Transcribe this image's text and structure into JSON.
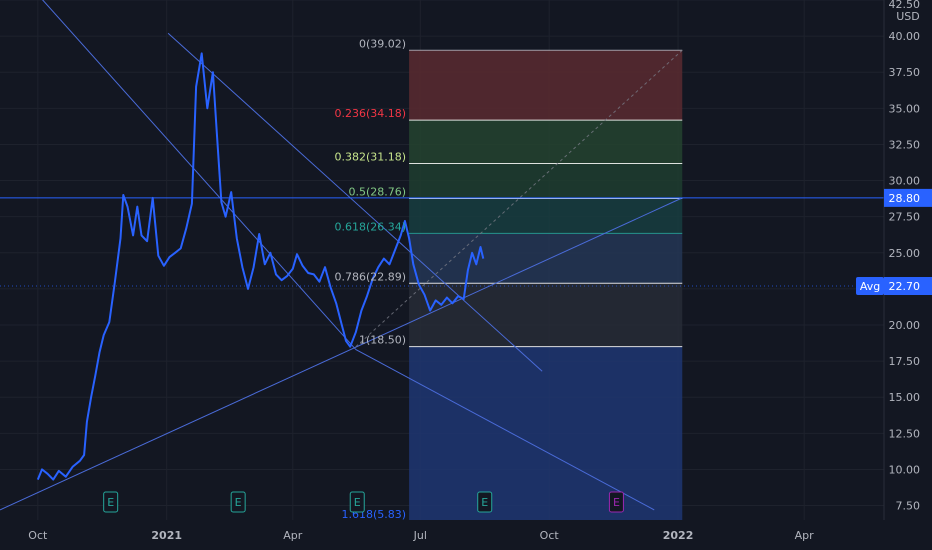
{
  "chart_data": {
    "type": "line",
    "currency": "USD",
    "y_axis": {
      "range": [
        6.5,
        42.5
      ],
      "ticks": [
        7.5,
        10.0,
        12.5,
        15.0,
        17.5,
        20.0,
        22.5,
        25.0,
        27.5,
        30.0,
        32.5,
        35.0,
        37.5,
        40.0,
        42.5
      ],
      "tick_labels": [
        "7.50",
        "10.00",
        "12.50",
        "15.00",
        "17.50",
        "20.00",
        "22.50",
        "25.00",
        "27.50",
        "30.00",
        "32.50",
        "35.00",
        "37.50",
        "40.00",
        "42.50"
      ],
      "position": "right"
    },
    "x_axis": {
      "range": [
        "2020-09-04",
        "2022-05-28"
      ],
      "ticks": [
        {
          "date": "2020-10-01",
          "label": "Oct"
        },
        {
          "date": "2021-01-01",
          "label": "2021",
          "bold": true
        },
        {
          "date": "2021-04-01",
          "label": "Apr"
        },
        {
          "date": "2021-07-01",
          "label": "Jul"
        },
        {
          "date": "2021-10-01",
          "label": "Oct"
        },
        {
          "date": "2022-01-01",
          "label": "2022",
          "bold": true
        },
        {
          "date": "2022-04-01",
          "label": "Apr"
        }
      ]
    },
    "grid": true,
    "series": [
      {
        "color": "#2962ff",
        "points": [
          [
            "2020-10-01",
            9.3
          ],
          [
            "2020-10-04",
            10.0
          ],
          [
            "2020-10-08",
            9.7
          ],
          [
            "2020-10-12",
            9.3
          ],
          [
            "2020-10-16",
            9.9
          ],
          [
            "2020-10-21",
            9.5
          ],
          [
            "2020-10-26",
            10.2
          ],
          [
            "2020-10-31",
            10.6
          ],
          [
            "2020-11-03",
            11.0
          ],
          [
            "2020-11-05",
            13.3
          ],
          [
            "2020-11-08",
            15.0
          ],
          [
            "2020-11-11",
            16.5
          ],
          [
            "2020-11-14",
            18.1
          ],
          [
            "2020-11-17",
            19.3
          ],
          [
            "2020-11-21",
            20.2
          ],
          [
            "2020-11-25",
            23.0
          ],
          [
            "2020-11-29",
            26.0
          ],
          [
            "2020-12-01",
            29.0
          ],
          [
            "2020-12-04",
            28.2
          ],
          [
            "2020-12-08",
            26.2
          ],
          [
            "2020-12-11",
            28.2
          ],
          [
            "2020-12-14",
            26.2
          ],
          [
            "2020-12-18",
            25.8
          ],
          [
            "2020-12-22",
            28.8
          ],
          [
            "2020-12-26",
            24.8
          ],
          [
            "2020-12-30",
            24.1
          ],
          [
            "2021-01-03",
            24.7
          ],
          [
            "2021-01-07",
            25.0
          ],
          [
            "2021-01-11",
            25.3
          ],
          [
            "2021-01-15",
            26.7
          ],
          [
            "2021-01-19",
            28.4
          ],
          [
            "2021-01-22",
            36.5
          ],
          [
            "2021-01-26",
            38.8
          ],
          [
            "2021-01-30",
            35.0
          ],
          [
            "2021-02-03",
            37.5
          ],
          [
            "2021-02-06",
            33.0
          ],
          [
            "2021-02-09",
            28.5
          ],
          [
            "2021-02-12",
            27.5
          ],
          [
            "2021-02-16",
            29.2
          ],
          [
            "2021-02-20",
            26.0
          ],
          [
            "2021-02-24",
            24.0
          ],
          [
            "2021-02-28",
            22.5
          ],
          [
            "2021-03-04",
            24.0
          ],
          [
            "2021-03-08",
            26.3
          ],
          [
            "2021-03-12",
            24.2
          ],
          [
            "2021-03-16",
            25.0
          ],
          [
            "2021-03-20",
            23.5
          ],
          [
            "2021-03-24",
            23.1
          ],
          [
            "2021-03-28",
            23.4
          ],
          [
            "2021-04-01",
            23.9
          ],
          [
            "2021-04-04",
            24.9
          ],
          [
            "2021-04-08",
            24.1
          ],
          [
            "2021-04-12",
            23.6
          ],
          [
            "2021-04-16",
            23.5
          ],
          [
            "2021-04-20",
            23.0
          ],
          [
            "2021-04-24",
            24.0
          ],
          [
            "2021-04-28",
            22.6
          ],
          [
            "2021-05-02",
            21.5
          ],
          [
            "2021-05-06",
            20.0
          ],
          [
            "2021-05-09",
            18.9
          ],
          [
            "2021-05-12",
            18.5
          ],
          [
            "2021-05-16",
            19.5
          ],
          [
            "2021-05-20",
            21.0
          ],
          [
            "2021-05-24",
            22.0
          ],
          [
            "2021-05-28",
            23.2
          ],
          [
            "2021-06-01",
            24.0
          ],
          [
            "2021-06-05",
            24.6
          ],
          [
            "2021-06-09",
            24.2
          ],
          [
            "2021-06-13",
            25.2
          ],
          [
            "2021-06-17",
            26.2
          ],
          [
            "2021-06-20",
            27.2
          ],
          [
            "2021-06-23",
            26.0
          ],
          [
            "2021-06-26",
            24.2
          ],
          [
            "2021-06-30",
            22.8
          ],
          [
            "2021-07-04",
            22.1
          ],
          [
            "2021-07-08",
            21.0
          ],
          [
            "2021-07-12",
            21.7
          ],
          [
            "2021-07-16",
            21.4
          ],
          [
            "2021-07-20",
            21.9
          ],
          [
            "2021-07-24",
            21.5
          ],
          [
            "2021-07-28",
            22.0
          ],
          [
            "2021-08-01",
            21.8
          ],
          [
            "2021-08-04",
            23.8
          ],
          [
            "2021-08-07",
            25.0
          ],
          [
            "2021-08-10",
            24.2
          ],
          [
            "2021-08-13",
            25.4
          ],
          [
            "2021-08-15",
            24.6
          ]
        ]
      }
    ],
    "trend_lines": [
      {
        "from": [
          "2020-09-28",
          43.2
        ],
        "to": [
          "2021-05-16",
          18.3
        ],
        "color": "#4a6bd8",
        "style": "solid"
      },
      {
        "from": [
          "2021-05-16",
          18.3
        ],
        "to": [
          "2021-12-15",
          7.2
        ],
        "color": "#4a6bd8",
        "style": "solid"
      },
      {
        "from": [
          "2020-09-04",
          7.2
        ],
        "to": [
          "2022-01-04",
          28.8
        ],
        "color": "#4a6bd8",
        "style": "solid"
      },
      {
        "from": [
          "2021-01-02",
          40.2
        ],
        "to": [
          "2021-09-26",
          16.8
        ],
        "color": "#4a6bd8",
        "style": "solid"
      },
      {
        "from": [
          "2021-05-16",
          18.5
        ],
        "to": [
          "2022-01-04",
          39.02
        ],
        "color": "#787b86",
        "style": "dashed"
      }
    ],
    "horizontal_line": {
      "value": 28.8,
      "label": "28.80",
      "color": "#2962ff"
    },
    "avg_line": {
      "value": 22.7,
      "label": "Avg",
      "value_label": "22.70",
      "color": "#2962ff"
    },
    "fibonacci": {
      "date_range": [
        "2021-06-23",
        "2022-01-04"
      ],
      "levels": [
        {
          "ratio": "0",
          "value": 39.02,
          "label": "0(39.02)",
          "line_color": "#b2b5be",
          "label_color": "#b2b5be",
          "fill": "#5a2a30"
        },
        {
          "ratio": "0.236",
          "value": 34.18,
          "label": "0.236(34.18)",
          "line_color": "#ffffff",
          "label_color": "#f23645",
          "fill": "#25432f"
        },
        {
          "ratio": "0.382",
          "value": 31.18,
          "label": "0.382(31.18)",
          "line_color": "#ffffff",
          "label_color": "#c6e48b",
          "fill": "#1f3d2f"
        },
        {
          "ratio": "0.5",
          "value": 28.76,
          "label": "0.5(28.76)",
          "line_color": "#ffffff",
          "label_color": "#81c784",
          "fill": "#173d3f"
        },
        {
          "ratio": "0.618",
          "value": 26.34,
          "label": "0.618(26.34)",
          "line_color": "#26a69a",
          "label_color": "#26a69a",
          "fill": "#243655"
        },
        {
          "ratio": "0.786",
          "value": 22.89,
          "label": "0.786(22.89)",
          "line_color": "#ffffff",
          "label_color": "#b2b5be",
          "fill": "#272c36"
        },
        {
          "ratio": "1",
          "value": 18.5,
          "label": "1(18.50)",
          "line_color": "#ffffff",
          "label_color": "#b2b5be",
          "fill": "#1e3672"
        },
        {
          "ratio": "1.618",
          "value": 5.83,
          "label": "1.618(5.83)",
          "line_color": "#2962ff",
          "label_color": "#2962ff",
          "fill": null
        }
      ]
    },
    "events": [
      {
        "date": "2020-11-22",
        "label": "E",
        "color": "#26a69a"
      },
      {
        "date": "2021-02-21",
        "label": "E",
        "color": "#26a69a"
      },
      {
        "date": "2021-05-17",
        "label": "E",
        "color": "#26a69a"
      },
      {
        "date": "2021-08-16",
        "label": "E",
        "color": "#26a69a"
      },
      {
        "date": "2021-11-18",
        "label": "E",
        "color": "#9c27b0"
      }
    ]
  }
}
